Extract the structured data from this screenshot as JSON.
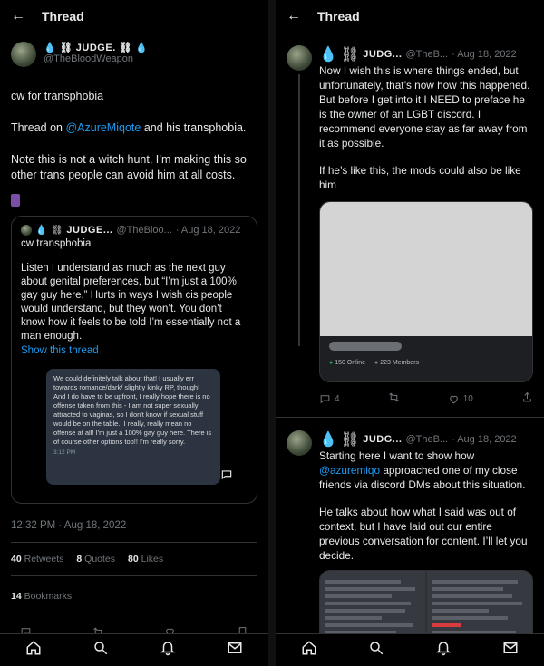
{
  "left": {
    "header_title": "Thread",
    "author": {
      "name": "JUDGE.",
      "handle": "@TheBloodWeapon"
    },
    "tweet_lines": [
      "cw for transphobia",
      "Thread on @AzureMiqote and his transphobia.",
      "Note this is not a witch hunt, I’m making this so other trans people can avoid him at all costs."
    ],
    "thread_prefix": "Thread on ",
    "mention": "@AzureMiqote",
    "thread_suffix": " and his transphobia.",
    "quote": {
      "name": "JUDGE...",
      "handle": "@TheBloo...",
      "date": "· Aug 18, 2022",
      "cw": "cw transphobia",
      "text": "Listen I understand as much as the next guy about genital preferences, but “I’m just a 100% gay guy here.” Hurts in ways I wish cis people would understand, but they won’t.  You don’t know how it feels to be told I’m essentially not a man enough.",
      "show_thread": "Show this thread",
      "message": "We could definitely talk about that! I usually err towards romance/dark/ slightly kinky RP, though! And I do have to be upfront, I really hope there is no offense taken from this - I am not super sexually attracted to vaginas, so I don't know if sexual stuff would be on the table.. I really, really mean no offense at all! I'm just a 100% gay guy here. There is of course other options too!! I'm really sorry.",
      "message_time": "3:12 PM"
    },
    "timestamp": "12:32 PM · Aug 18, 2022",
    "stats": {
      "retweets_count": "40",
      "retweets_label": "Retweets",
      "quotes_count": "8",
      "quotes_label": "Quotes",
      "likes_count": "80",
      "likes_label": "Likes",
      "bookmarks_count": "14",
      "bookmarks_label": "Bookmarks"
    }
  },
  "right": {
    "header_title": "Thread",
    "tweet1": {
      "name": "JUDG...",
      "handle": "@TheB...",
      "date": "· Aug 18, 2022",
      "text": "Now I wish this is where things ended, but unfortunately, that’s now how this happened. But before I get into it I  NEED to preface he is the owner of an LGBT discord.  I recommend everyone stay as far away from it as possible.",
      "text2": "If he’s like this, the mods could also be like him",
      "online": "150 Online",
      "members": "223 Members",
      "replies": "4",
      "likes": "10"
    },
    "tweet2": {
      "name": "JUDG...",
      "handle": "@TheB...",
      "date": "· Aug 18, 2022",
      "text_prefix": "Starting here I want to show how ",
      "mention": "@azuremiqo",
      "text_suffix": " approached one of my close friends via discord DMs about this situation.",
      "text2": "He talks about how what I said was out of context, but I have laid out our entire previous conversation for content. I’ll let you decide."
    }
  },
  "colors": {
    "accent": "#1d9bf0",
    "background": "#000000",
    "border": "#2f3336",
    "muted": "#71767b",
    "blood": "#e0245e"
  },
  "icons": [
    "back-arrow-icon",
    "blood-drop-icon",
    "chain-icon",
    "home-icon",
    "search-icon",
    "bell-icon",
    "mail-icon",
    "reply-icon",
    "retweet-icon",
    "heart-icon",
    "share-icon",
    "bookmark-icon"
  ]
}
